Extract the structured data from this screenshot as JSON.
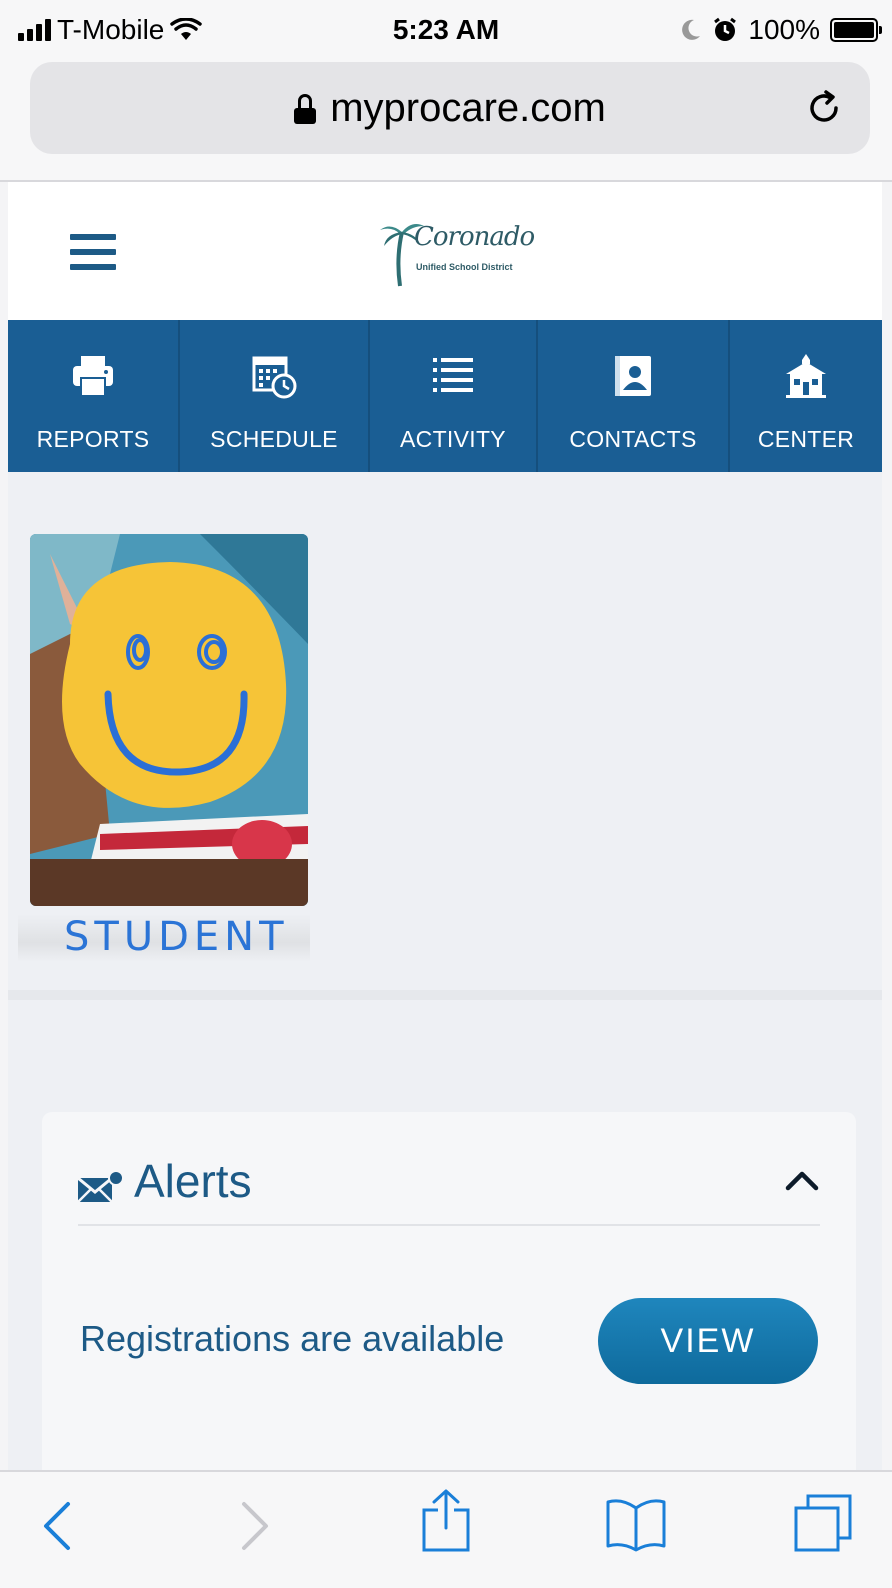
{
  "status_bar": {
    "carrier": "T-Mobile",
    "time": "5:23 AM",
    "battery": "100%"
  },
  "browser": {
    "url": "myprocare.com"
  },
  "header": {
    "logo_script": "Coronado",
    "logo_sub": "Unified School District"
  },
  "nav": {
    "items": [
      {
        "label": "REPORTS",
        "icon": "printer-icon"
      },
      {
        "label": "SCHEDULE",
        "icon": "calendar-clock-icon"
      },
      {
        "label": "ACTIVITY",
        "icon": "list-icon"
      },
      {
        "label": "CONTACTS",
        "icon": "contact-book-icon"
      },
      {
        "label": "CENTER",
        "icon": "schoolhouse-icon"
      }
    ]
  },
  "student": {
    "label": "STUDENT"
  },
  "alerts": {
    "title": "Alerts",
    "message": "Registrations are available",
    "view_label": "VIEW"
  },
  "colors": {
    "brand": "#1a5e94",
    "text": "#1d5a86",
    "button": "#0e6a9c"
  }
}
